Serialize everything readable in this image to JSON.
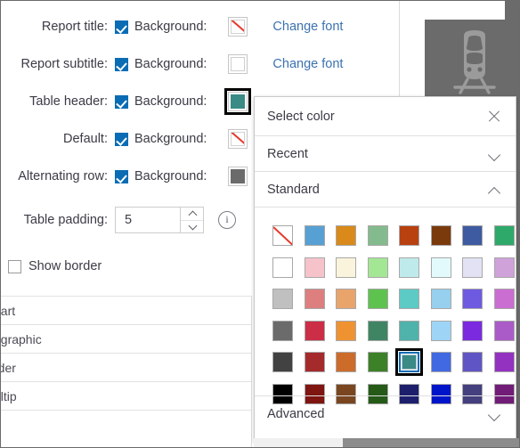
{
  "panel": {
    "rows": [
      {
        "label": "Report title:",
        "checkbox_label": "Background:",
        "checked": true,
        "swatch": "none",
        "link": "Change font"
      },
      {
        "label": "Report subtitle:",
        "checkbox_label": "Background:",
        "checked": true,
        "swatch": "white",
        "link": "Change font"
      },
      {
        "label": "Table header:",
        "checkbox_label": "Background:",
        "checked": true,
        "swatch": "#3a8a86",
        "link": ""
      },
      {
        "label": "Default:",
        "checkbox_label": "Background:",
        "checked": true,
        "swatch": "none",
        "link": ""
      },
      {
        "label": "Alternating row:",
        "checkbox_label": "Background:",
        "checked": true,
        "swatch": "#6b6b6b",
        "link": ""
      }
    ],
    "padding": {
      "label": "Table padding:",
      "value": "5",
      "up_icon": "chevron-up-icon",
      "down_icon": "chevron-down-icon",
      "info_icon": "info-icon"
    },
    "show_border": {
      "label": "Show border",
      "checked": false
    },
    "list_rows": [
      {
        "text": "hart"
      },
      {
        "text": "ographic"
      },
      {
        "text": "rder"
      },
      {
        "text": "oltip"
      },
      {
        "text": ""
      }
    ]
  },
  "preview": {
    "icon": "train-icon",
    "background": "#6b6b6b"
  },
  "picker": {
    "title": "Select color",
    "close_icon": "close-icon",
    "sections": [
      {
        "label": "Recent",
        "icon": "chevron-down-icon",
        "expanded": false
      },
      {
        "label": "Standard",
        "icon": "chevron-up-icon",
        "expanded": true
      },
      {
        "label": "Advanced",
        "icon": "chevron-down-icon",
        "expanded": false
      }
    ],
    "selected_color": "#3a8a86",
    "selected_index": 36,
    "standard_colors": [
      "none",
      "#57a0d3",
      "#d98a1b",
      "#84bb8e",
      "#b8410f",
      "#7b3a0c",
      "#3e5aa0",
      "#2fa96a",
      "#ffffff",
      "#f6c3cb",
      "#fbf4dc",
      "#a3e694",
      "#bfeaec",
      "#e3fafc",
      "#e2e2f4",
      "#cfa2da",
      "#c0c0c0",
      "#dd7f7f",
      "#e8a46b",
      "#5dc34e",
      "#5dcac5",
      "#97cfee",
      "#6e5ae0",
      "#cb6ed1",
      "#6b6b6b",
      "#cb2e46",
      "#ef9231",
      "#3f8564",
      "#4fb2ab",
      "#9ed4f5",
      "#7b2ae0",
      "#ab5bc8",
      "#424242",
      "#a52a2c",
      "#cd6c2a",
      "#3c8128",
      "#3a8a86",
      "#4169e1",
      "#6055c4",
      "#9332c0",
      "#000000",
      "#7e1510",
      "#7a4620",
      "#255a17",
      "#1d1f6d",
      "#0015c9",
      "#443f7e",
      "#711d78"
    ]
  },
  "scrollbar": {
    "horizontal_name": "horizontal-scrollbar",
    "vertical_name": "vertical-scrollbar"
  }
}
